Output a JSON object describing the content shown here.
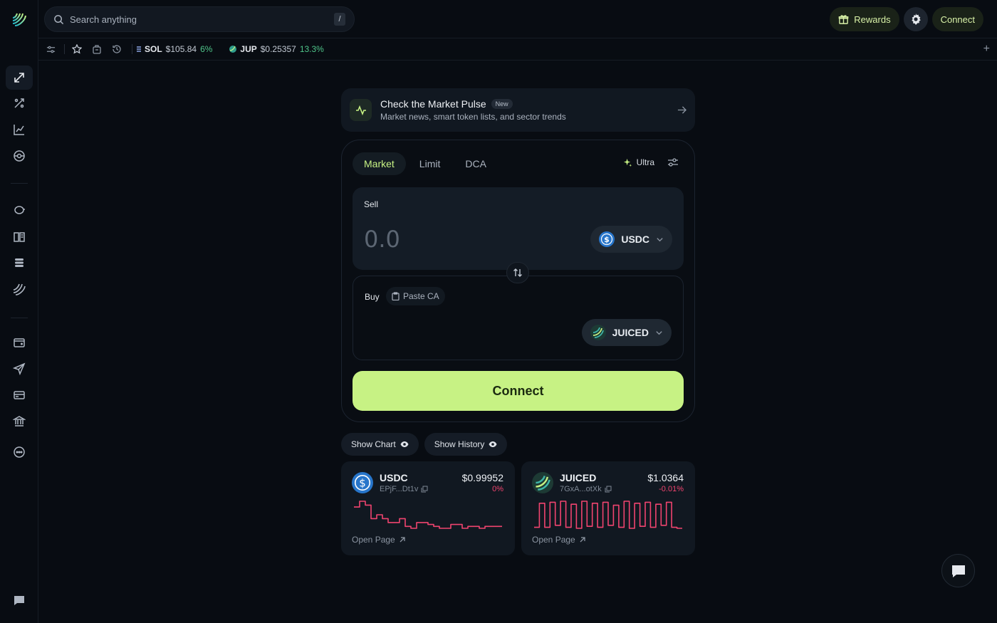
{
  "search": {
    "placeholder": "Search anything",
    "shortcut": "/"
  },
  "top_actions": {
    "rewards_label": "Rewards",
    "connect_label": "Connect"
  },
  "ticker": [
    {
      "symbol": "SOL",
      "price": "$105.84",
      "change": "6%"
    },
    {
      "symbol": "JUP",
      "price": "$0.25357",
      "change": "13.3%"
    }
  ],
  "pulse": {
    "title": "Check the Market Pulse",
    "badge": "New",
    "subtitle": "Market news, smart token lists, and sector trends"
  },
  "swap": {
    "tabs": [
      "Market",
      "Limit",
      "DCA"
    ],
    "mode_label": "Ultra",
    "sell_label": "Sell",
    "sell_amount": "0.0",
    "sell_token": "USDC",
    "buy_label": "Buy",
    "paste_label": "Paste CA",
    "buy_token": "JUICED",
    "connect_label": "Connect"
  },
  "toggles": {
    "show_chart": "Show Chart",
    "show_history": "Show History"
  },
  "cards": [
    {
      "name": "USDC",
      "address": "EPjF...Dt1v",
      "price": "$0.99952",
      "change": "0%",
      "open_label": "Open Page",
      "spark": [
        6,
        3,
        5,
        12,
        10,
        12,
        14,
        14,
        12,
        16,
        17,
        14,
        14,
        15,
        16,
        17,
        17,
        15,
        15,
        17,
        16,
        16,
        17,
        16,
        16,
        16
      ]
    },
    {
      "name": "JUICED",
      "address": "7GxA...otXk",
      "price": "$1.0364",
      "change": "-0.01%",
      "open_label": "Open Page",
      "spark": [
        30,
        6,
        30,
        5,
        28,
        4,
        30,
        7,
        31,
        4,
        29,
        6,
        30,
        5,
        28,
        8,
        30,
        4,
        31,
        6,
        29,
        5,
        30,
        7,
        28,
        5,
        30,
        31
      ]
    }
  ],
  "colors": {
    "accent": "#c7f284",
    "positive": "#4fc58a",
    "negative": "#f0446f",
    "background": "#080c12"
  }
}
